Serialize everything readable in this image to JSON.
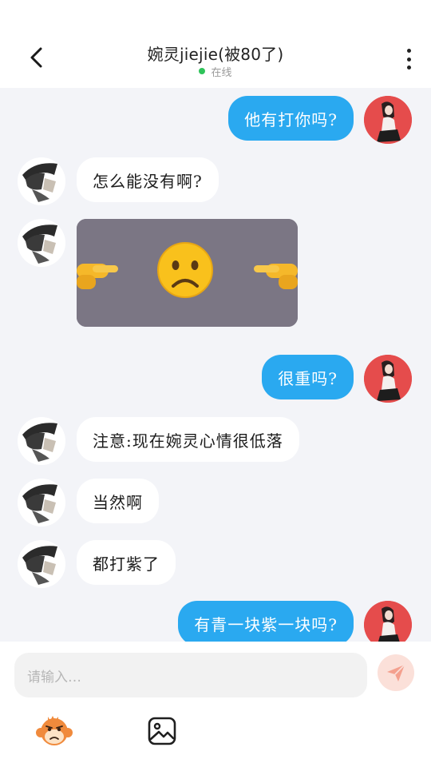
{
  "header": {
    "title": "婉灵jiejie(被80了)",
    "status": "在线",
    "status_color": "#2fc35a"
  },
  "messages": [
    {
      "side": "out",
      "type": "text",
      "text": "他有打你吗?"
    },
    {
      "side": "in",
      "type": "text",
      "text": "怎么能没有啊?"
    },
    {
      "side": "in",
      "type": "sticker",
      "sticker": "sad-face-pointing-fingers"
    },
    {
      "side": "out",
      "type": "text",
      "text": "很重吗?"
    },
    {
      "side": "in",
      "type": "text",
      "text": "注意:现在婉灵心情很低落"
    },
    {
      "side": "in",
      "type": "text",
      "text": "当然啊"
    },
    {
      "side": "in",
      "type": "text",
      "text": "都打紫了"
    },
    {
      "side": "out",
      "type": "text",
      "text": "有青一块紫一块吗?"
    }
  ],
  "composer": {
    "placeholder": "请输入…",
    "send_icon": "paper-plane-icon",
    "tools": [
      "monkey-emoji-icon",
      "image-icon"
    ]
  },
  "colors": {
    "outgoing_bubble": "#2aa9f0",
    "incoming_bubble": "#ffffff",
    "chat_background": "#f3f4f8",
    "send_button": "#fbe0d9"
  }
}
